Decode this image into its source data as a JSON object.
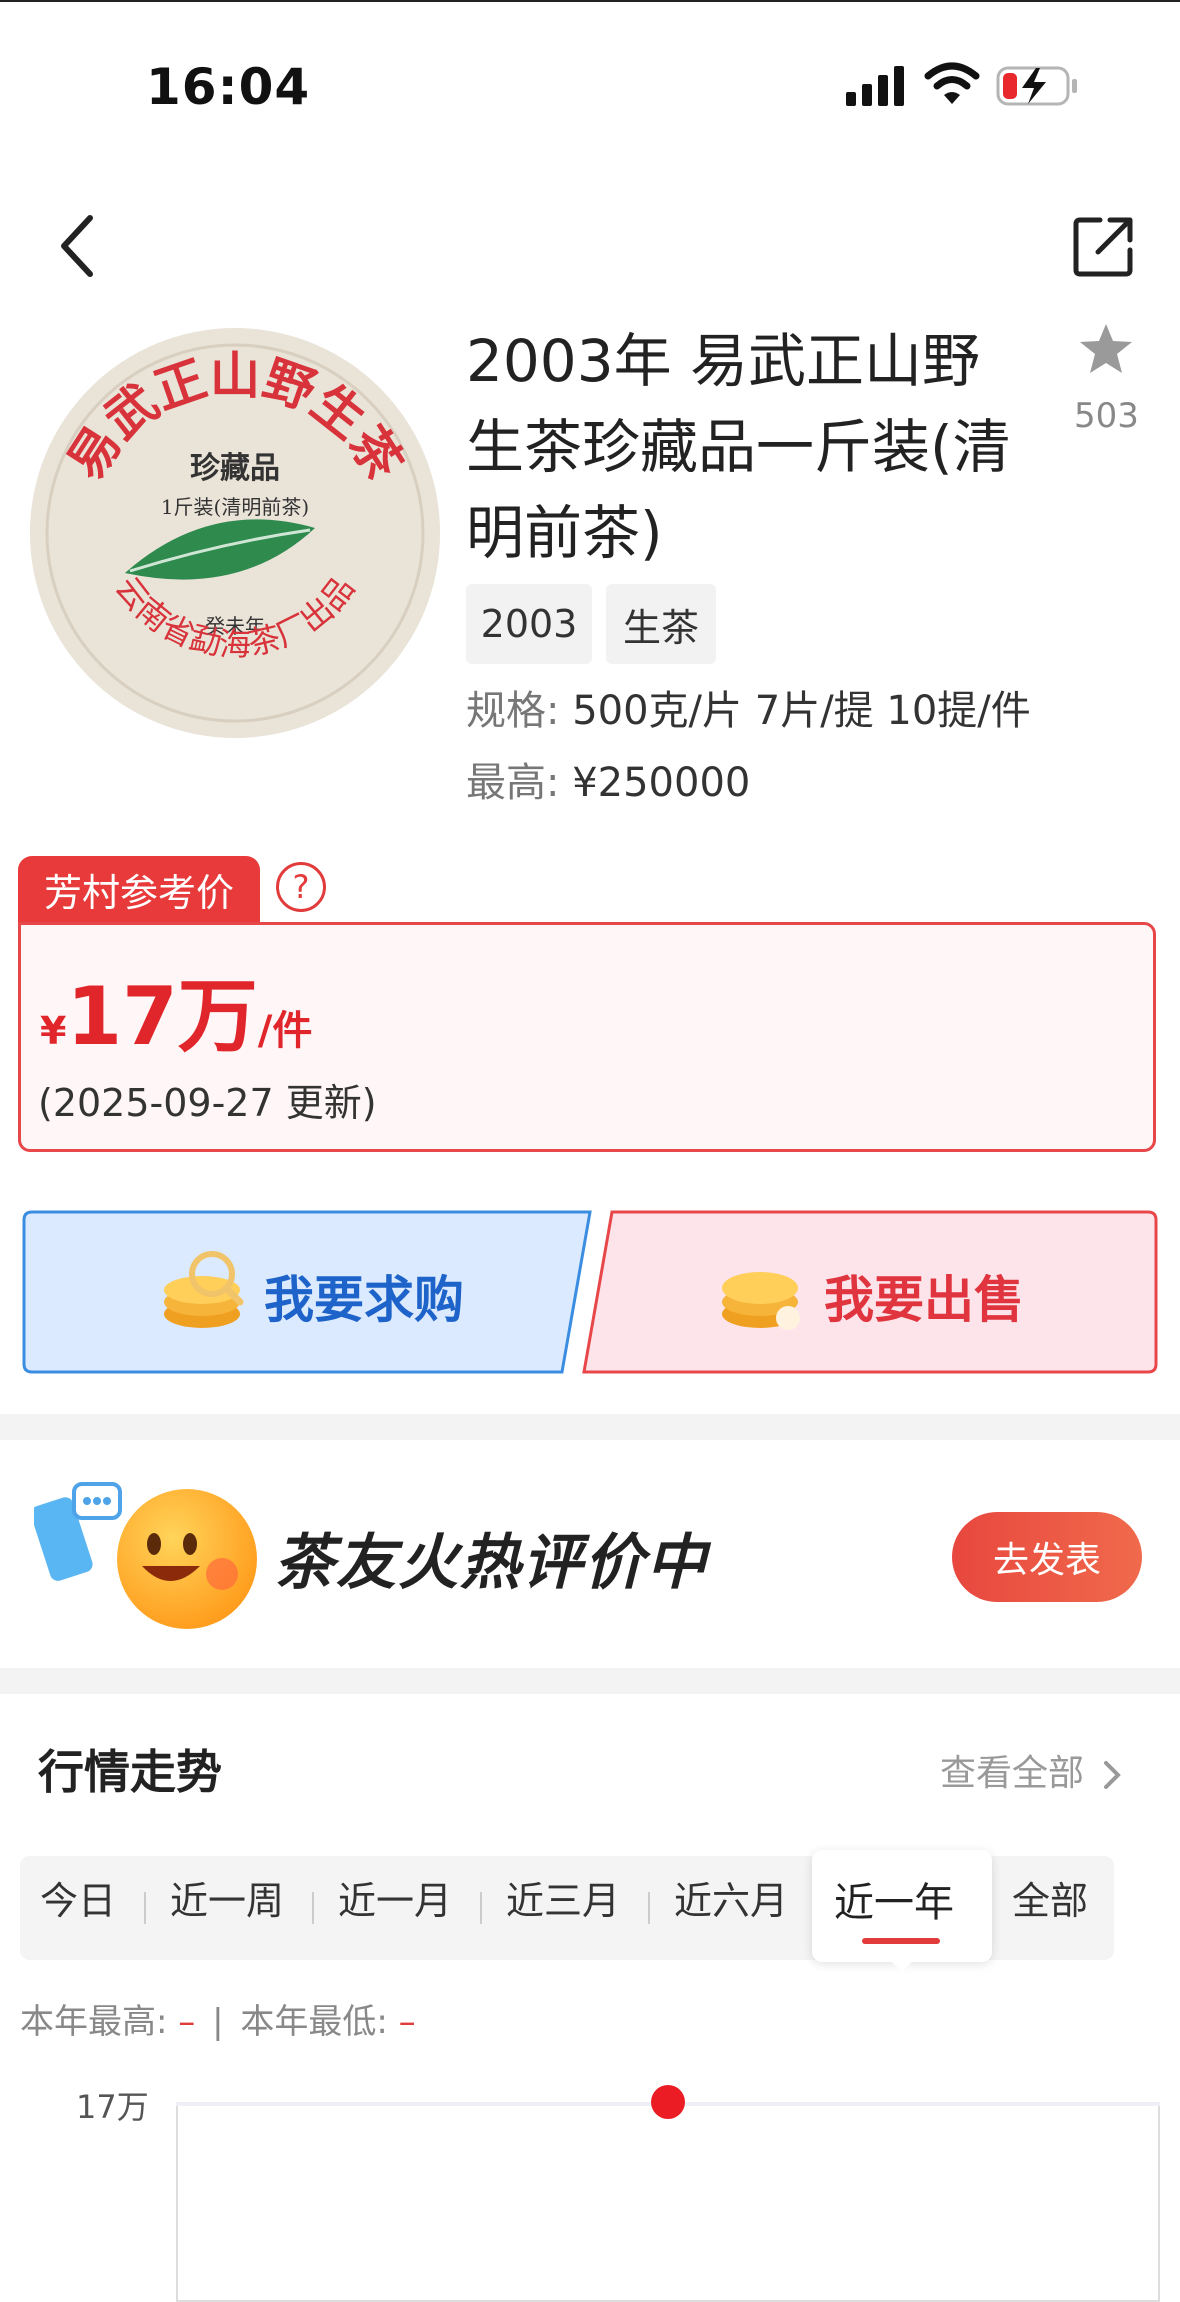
{
  "status_bar": {
    "time": "16:04"
  },
  "product": {
    "title": "2003年 易武正山野生茶珍藏品一斤装(清明前茶)",
    "favorite_count": "503",
    "tags": [
      "2003",
      "生茶"
    ],
    "spec_label": "规格:",
    "spec_value": "500克/片 7片/提 10提/件",
    "max_label": "最高:",
    "max_value": "¥250000",
    "image_text": {
      "arc_top": "易武正山野生茶",
      "center_title": "珍藏品",
      "center_sub": "1斤装(清明前茶)",
      "year": "癸未年",
      "arc_bottom": "云南省勐海茶厂出品"
    }
  },
  "reference_price": {
    "tab_label": "芳村参考价",
    "help_icon": "?",
    "currency": "¥",
    "amount": "17万",
    "unit": "/件",
    "updated": "(2025-09-27 更新)"
  },
  "actions": {
    "buy_label": "我要求购",
    "sell_label": "我要出售",
    "buy_bg": "#dbeafe",
    "sell_bg": "#fde4ea"
  },
  "banner": {
    "text": "茶友火热评价中",
    "publish_label": "去发表"
  },
  "trend": {
    "title": "行情走势",
    "see_all": "查看全部",
    "tabs": [
      "今日",
      "近一周",
      "近一月",
      "近三月",
      "近六月",
      "近一年",
      "全部"
    ],
    "active_tab": "近一年",
    "year_high_label": "本年最高:",
    "year_high_value": "–",
    "year_low_label": "本年最低:",
    "year_low_value": "–",
    "separator": "|",
    "y_label_top": "17万"
  },
  "colors": {
    "accent_red": "#e23b3b",
    "price_red": "#e0262b",
    "buy_blue": "#1e63c9",
    "sell_red": "#e0353f"
  }
}
